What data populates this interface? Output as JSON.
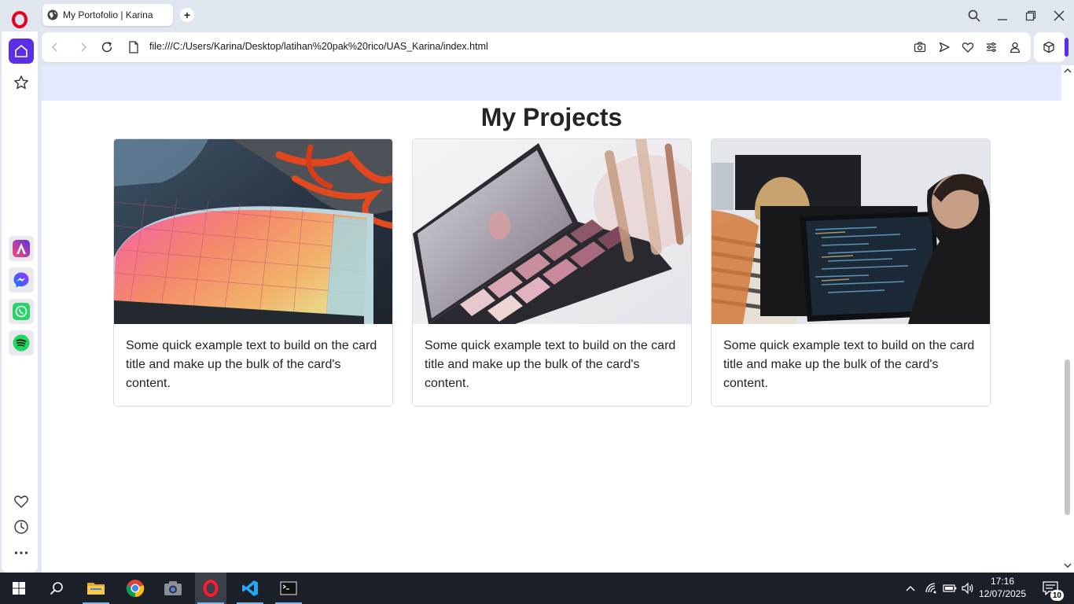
{
  "browser": {
    "tab_title": "My Portofolio | Karina",
    "new_tab_symbol": "+",
    "url": "file:///C:/Users/Karina/Desktop/latihan%20pak%20rico/UAS_Karina/index.html"
  },
  "page": {
    "heading": "My Projects",
    "cards": [
      {
        "image": "keyboard-and-sneakers-photo",
        "text": "Some quick example text to build on the card title and make up the bulk of the card's content."
      },
      {
        "image": "makeup-palette-photo",
        "text": "Some quick example text to build on the card title and make up the bulk of the card's content."
      },
      {
        "image": "programmers-at-computer-photo",
        "text": "Some quick example text to build on the card title and make up the bulk of the card's content."
      }
    ]
  },
  "sidebar": {
    "apps": [
      "aria-icon",
      "messenger-icon",
      "whatsapp-icon",
      "spotify-icon"
    ]
  },
  "taskbar": {
    "time": "17:16",
    "date": "12/07/2025",
    "notifications": "10"
  },
  "colors": {
    "accent": "#5b2ee8",
    "hero_strip": "#e3eaff",
    "taskbar": "#1b1f27",
    "chrome": "#dfe6ef"
  }
}
